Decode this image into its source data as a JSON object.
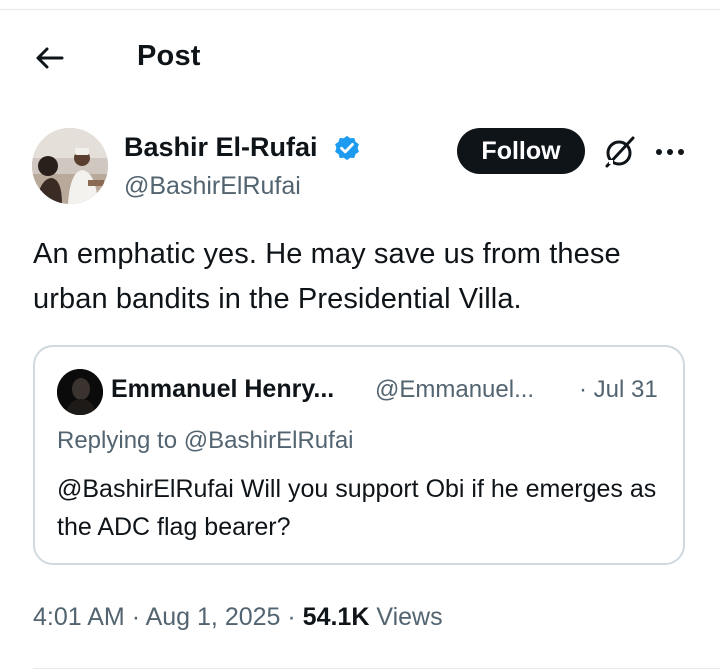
{
  "header": {
    "title": "Post",
    "back_icon": "arrow-left-icon"
  },
  "author": {
    "name": "Bashir El-Rufai",
    "handle": "@BashirElRufai",
    "verified": true,
    "verified_color": "#1d9bf0",
    "follow_label": "Follow"
  },
  "tweet": {
    "text": "An emphatic yes. He may save us from these urban bandits in the Presidential Villa."
  },
  "quote": {
    "name": "Emmanuel Henry...",
    "handle": "@Emmanuel...",
    "date": "· Jul 31",
    "replying_to": "Replying to @BashirElRufai",
    "text": "@BashirElRufai Will you support Obi if he emerges as the ADC flag bearer?"
  },
  "meta": {
    "time": "4:01 AM",
    "date": "Aug 1, 2025",
    "views_count": "54.1K",
    "views_label": "Views",
    "separator": "·"
  },
  "colors": {
    "text": "#0f1419",
    "secondary": "#536471",
    "border": "#cfd9de",
    "accent": "#1d9bf0"
  }
}
